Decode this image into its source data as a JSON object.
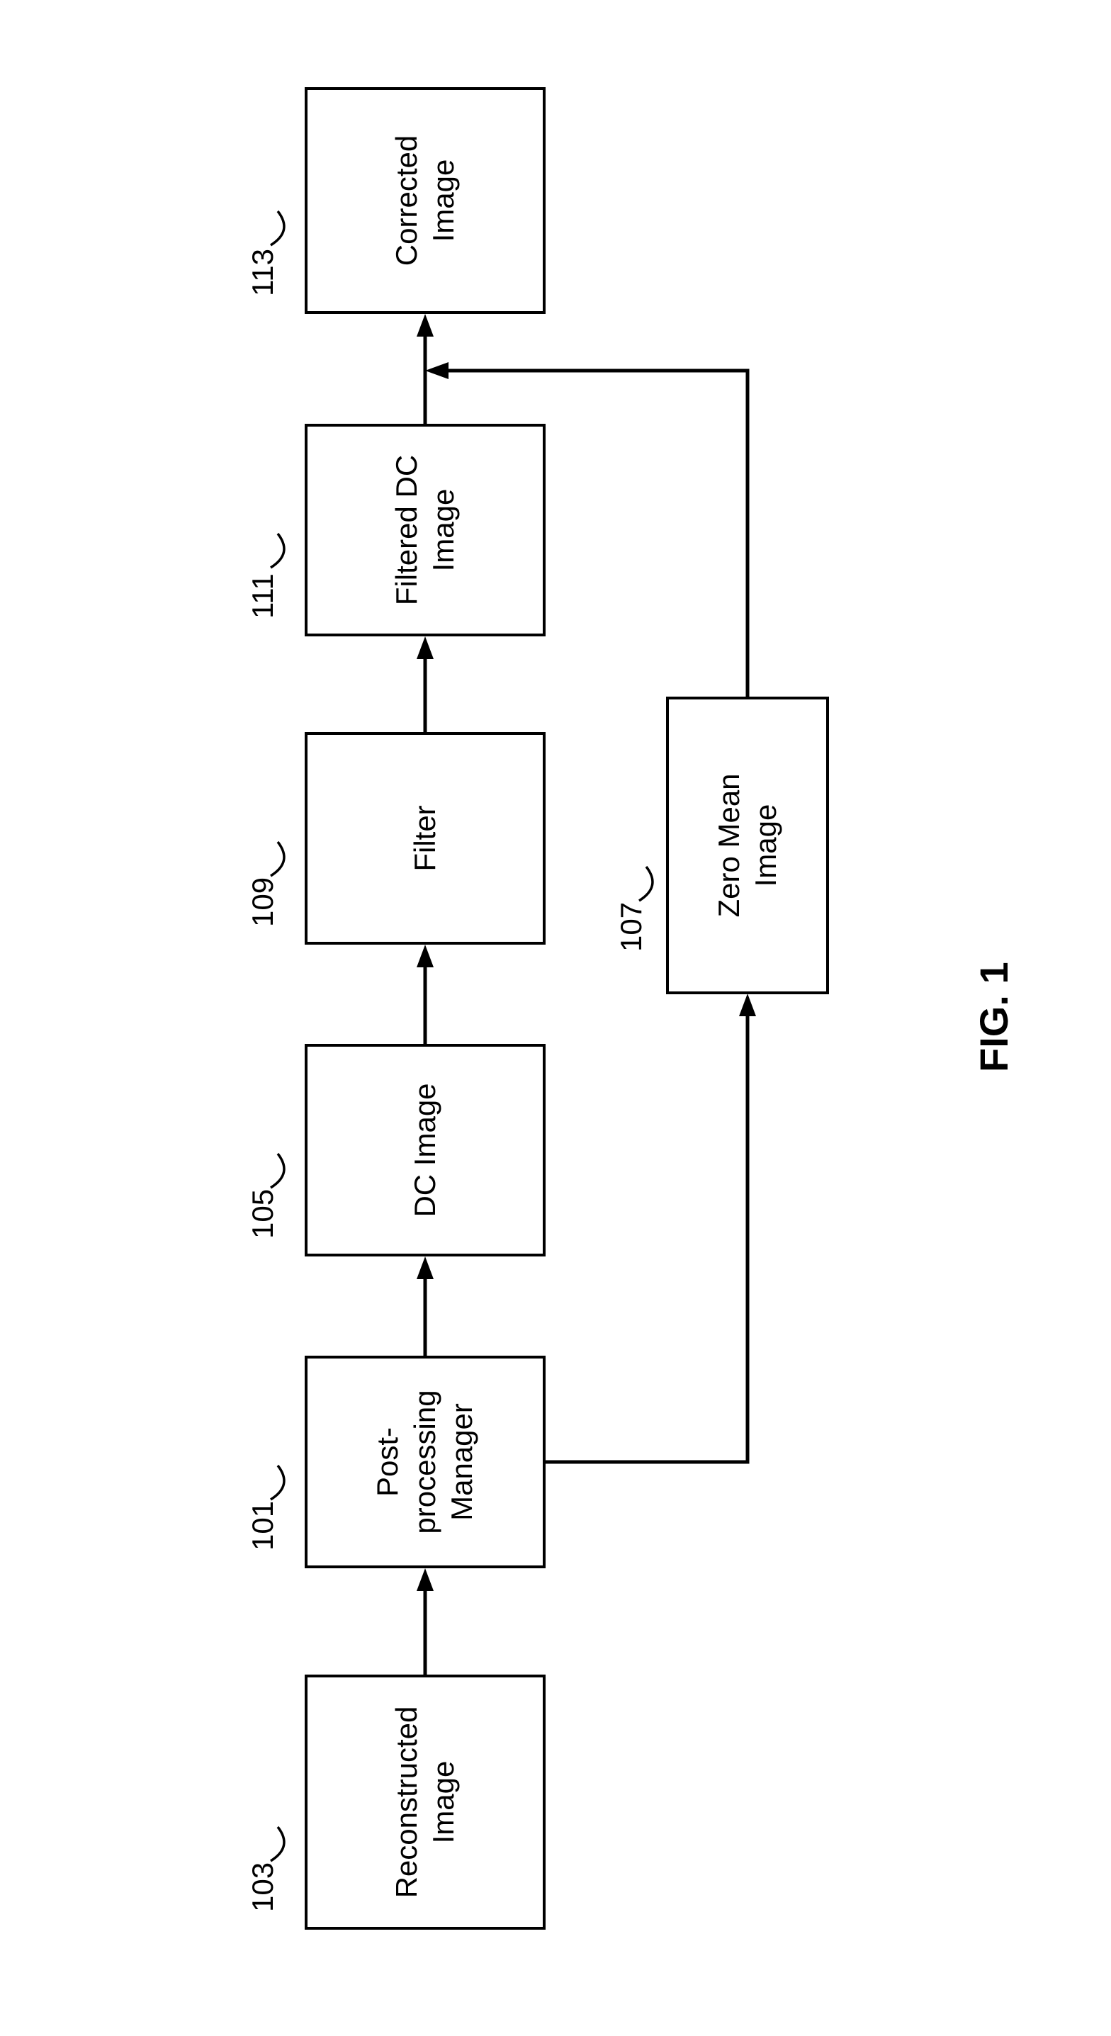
{
  "nodes": {
    "reconstructed": {
      "id": "103",
      "label": "Reconstructed\nImage"
    },
    "ppm": {
      "id": "101",
      "label": "Post-\nprocessing\nManager"
    },
    "dc": {
      "id": "105",
      "label": "DC Image"
    },
    "filter": {
      "id": "109",
      "label": "Filter"
    },
    "filtered": {
      "id": "111",
      "label": "Filtered DC\nImage"
    },
    "corrected": {
      "id": "113",
      "label": "Corrected\nImage"
    },
    "zeromean": {
      "id": "107",
      "label": "Zero Mean\nImage"
    }
  },
  "caption": "FIG. 1"
}
